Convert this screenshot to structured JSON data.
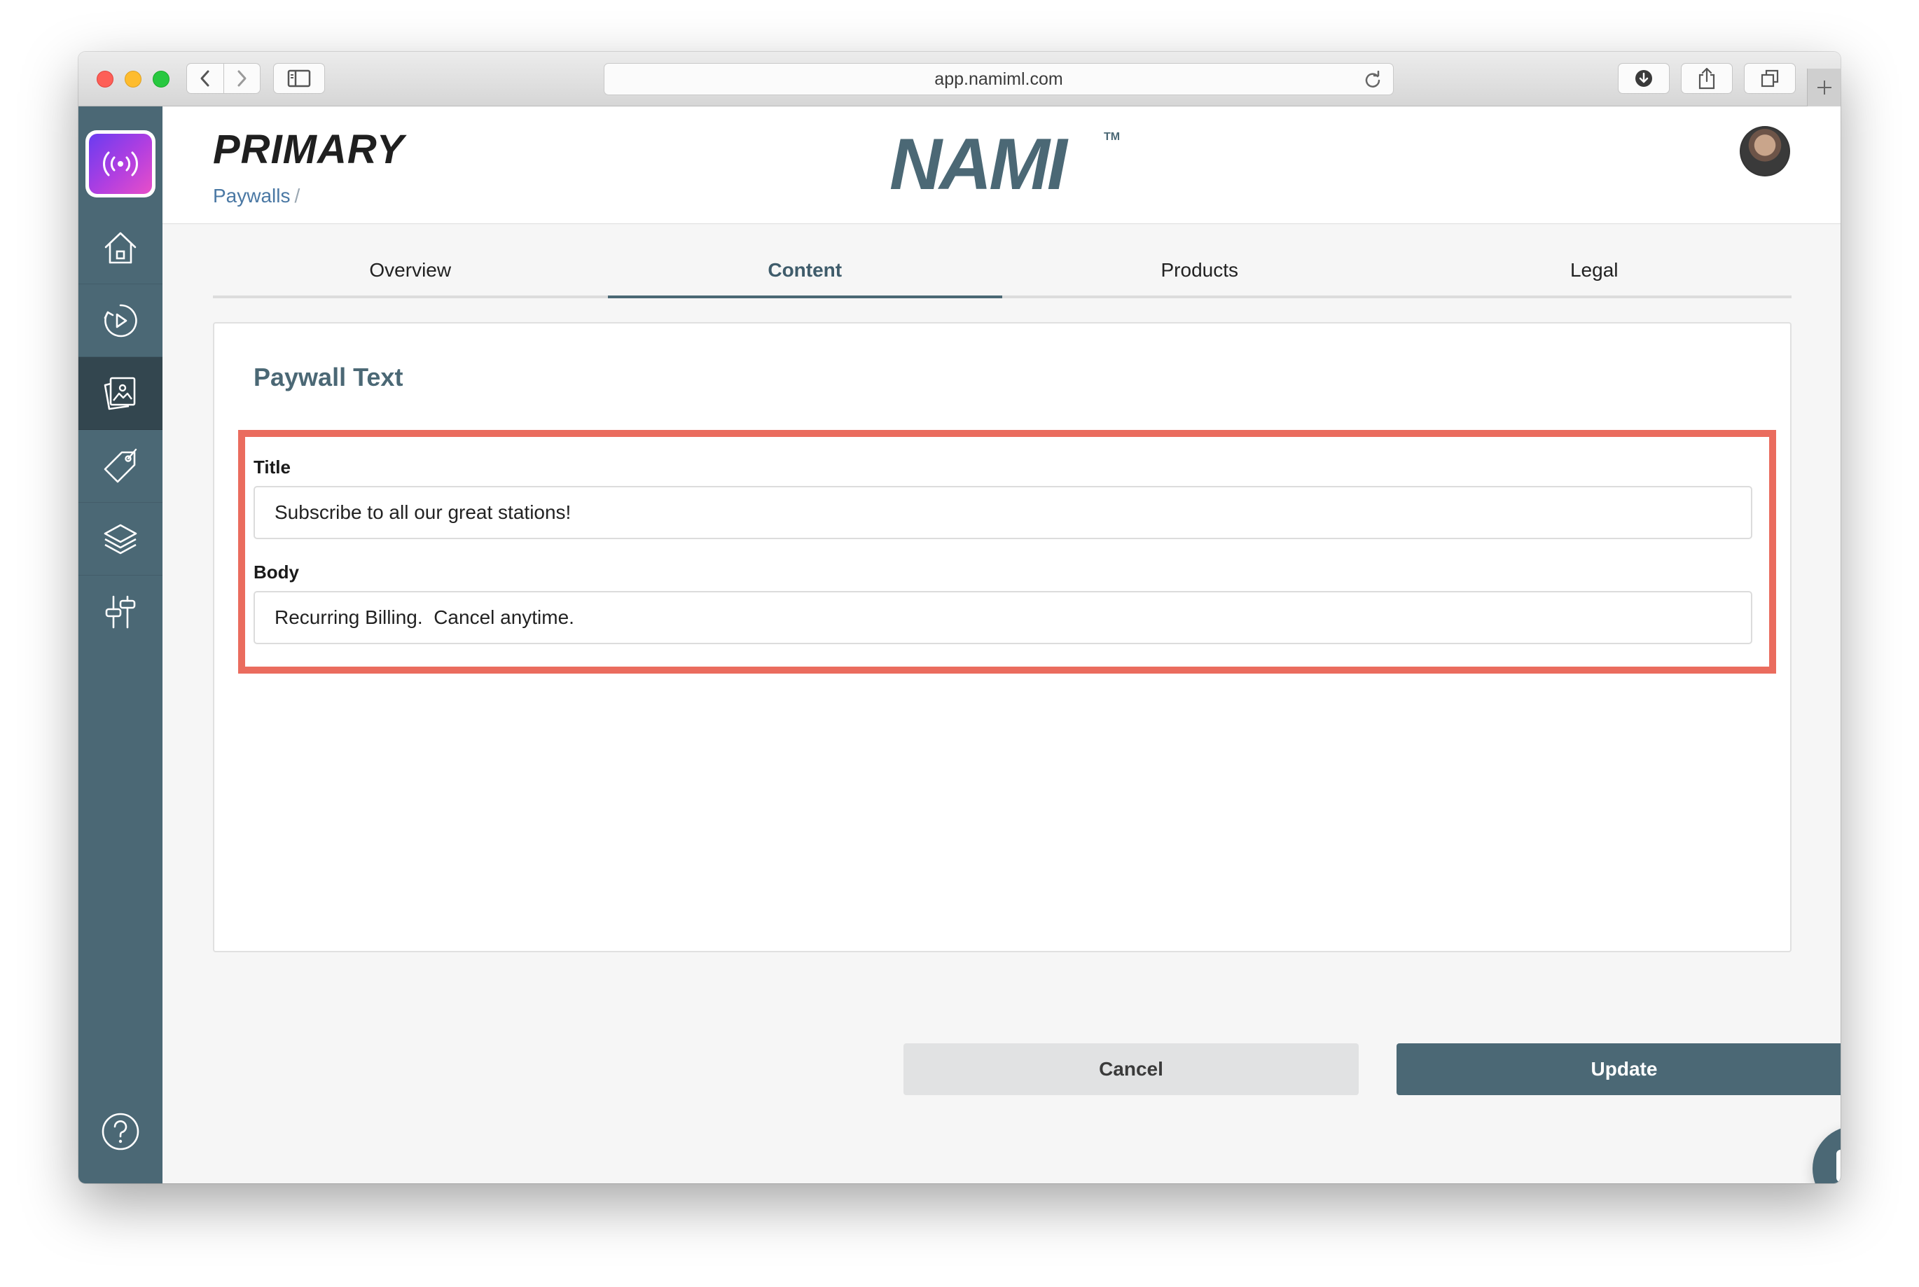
{
  "browser": {
    "url": "app.namiml.com",
    "icons": {
      "back": "chevron-left-icon",
      "forward": "chevron-right-icon",
      "sidebar": "sidebar-icon",
      "reload": "reload-icon",
      "download": "download-icon",
      "share": "share-icon",
      "tabs": "tabs-icon",
      "new_tab": "plus-icon"
    }
  },
  "sidenav": {
    "items": [
      {
        "icon": "home-icon"
      },
      {
        "icon": "campaign-icon"
      },
      {
        "icon": "paywall-icon",
        "active": true
      },
      {
        "icon": "tag-icon"
      },
      {
        "icon": "layers-icon"
      },
      {
        "icon": "settings-sliders-icon"
      }
    ],
    "help_icon": "help-icon"
  },
  "header": {
    "app_name": "PRIMARY",
    "breadcrumb": "Paywalls",
    "breadcrumb_separator": "/",
    "brand": "NAMI",
    "brand_tm": "TM"
  },
  "tabs": [
    {
      "label": "Overview"
    },
    {
      "label": "Content",
      "active": true
    },
    {
      "label": "Products"
    },
    {
      "label": "Legal"
    }
  ],
  "card": {
    "title": "Paywall Text",
    "fields": {
      "title_label": "Title",
      "title_value": "Subscribe to all our great stations!",
      "body_label": "Body",
      "body_value": "Recurring Billing.  Cancel anytime."
    }
  },
  "actions": {
    "cancel": "Cancel",
    "update": "Update"
  },
  "colors": {
    "sidebar": "#4b6875",
    "sidebar_active": "#33464f",
    "accent": "#4b6875",
    "highlight": "#ea6c5e",
    "link": "#4a78a4"
  }
}
